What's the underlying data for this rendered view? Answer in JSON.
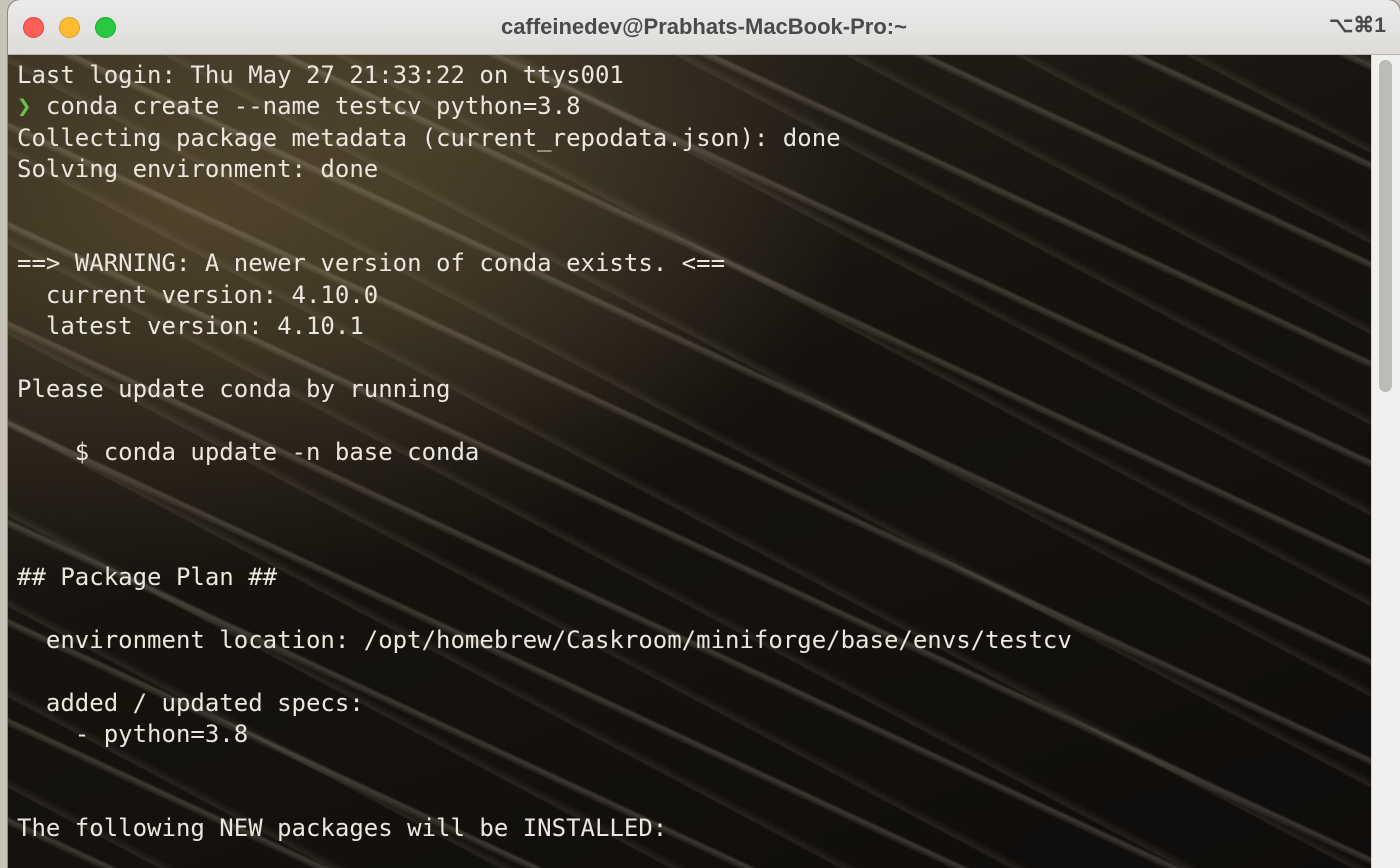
{
  "window": {
    "title": "caffeinedev@Prabhats-MacBook-Pro:~",
    "shortcut": "⌥⌘1"
  },
  "terminal": {
    "prompt_symbol": "❯",
    "lines": [
      "Last login: Thu May 27 21:33:22 on ttys001",
      "conda create --name testcv python=3.8",
      "Collecting package metadata (current_repodata.json): done",
      "Solving environment: done",
      "",
      "",
      "==> WARNING: A newer version of conda exists. <==",
      "  current version: 4.10.0",
      "  latest version: 4.10.1",
      "",
      "Please update conda by running",
      "",
      "    $ conda update -n base conda",
      "",
      "",
      "",
      "## Package Plan ##",
      "",
      "  environment location: /opt/homebrew/Caskroom/miniforge/base/envs/testcv",
      "",
      "  added / updated specs:",
      "    - python=3.8",
      "",
      "",
      "The following NEW packages will be INSTALLED:"
    ]
  },
  "scrollbar": {
    "position_fraction": 0.0,
    "visible_fraction": 0.41
  }
}
